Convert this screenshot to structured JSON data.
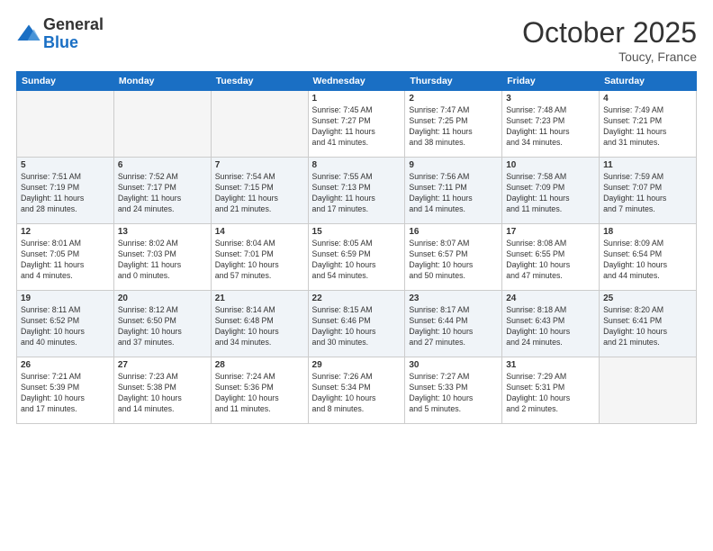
{
  "header": {
    "logo_general": "General",
    "logo_blue": "Blue",
    "month": "October 2025",
    "location": "Toucy, France"
  },
  "days_of_week": [
    "Sunday",
    "Monday",
    "Tuesday",
    "Wednesday",
    "Thursday",
    "Friday",
    "Saturday"
  ],
  "weeks": [
    [
      {
        "day": "",
        "info": ""
      },
      {
        "day": "",
        "info": ""
      },
      {
        "day": "",
        "info": ""
      },
      {
        "day": "1",
        "info": "Sunrise: 7:45 AM\nSunset: 7:27 PM\nDaylight: 11 hours\nand 41 minutes."
      },
      {
        "day": "2",
        "info": "Sunrise: 7:47 AM\nSunset: 7:25 PM\nDaylight: 11 hours\nand 38 minutes."
      },
      {
        "day": "3",
        "info": "Sunrise: 7:48 AM\nSunset: 7:23 PM\nDaylight: 11 hours\nand 34 minutes."
      },
      {
        "day": "4",
        "info": "Sunrise: 7:49 AM\nSunset: 7:21 PM\nDaylight: 11 hours\nand 31 minutes."
      }
    ],
    [
      {
        "day": "5",
        "info": "Sunrise: 7:51 AM\nSunset: 7:19 PM\nDaylight: 11 hours\nand 28 minutes."
      },
      {
        "day": "6",
        "info": "Sunrise: 7:52 AM\nSunset: 7:17 PM\nDaylight: 11 hours\nand 24 minutes."
      },
      {
        "day": "7",
        "info": "Sunrise: 7:54 AM\nSunset: 7:15 PM\nDaylight: 11 hours\nand 21 minutes."
      },
      {
        "day": "8",
        "info": "Sunrise: 7:55 AM\nSunset: 7:13 PM\nDaylight: 11 hours\nand 17 minutes."
      },
      {
        "day": "9",
        "info": "Sunrise: 7:56 AM\nSunset: 7:11 PM\nDaylight: 11 hours\nand 14 minutes."
      },
      {
        "day": "10",
        "info": "Sunrise: 7:58 AM\nSunset: 7:09 PM\nDaylight: 11 hours\nand 11 minutes."
      },
      {
        "day": "11",
        "info": "Sunrise: 7:59 AM\nSunset: 7:07 PM\nDaylight: 11 hours\nand 7 minutes."
      }
    ],
    [
      {
        "day": "12",
        "info": "Sunrise: 8:01 AM\nSunset: 7:05 PM\nDaylight: 11 hours\nand 4 minutes."
      },
      {
        "day": "13",
        "info": "Sunrise: 8:02 AM\nSunset: 7:03 PM\nDaylight: 11 hours\nand 0 minutes."
      },
      {
        "day": "14",
        "info": "Sunrise: 8:04 AM\nSunset: 7:01 PM\nDaylight: 10 hours\nand 57 minutes."
      },
      {
        "day": "15",
        "info": "Sunrise: 8:05 AM\nSunset: 6:59 PM\nDaylight: 10 hours\nand 54 minutes."
      },
      {
        "day": "16",
        "info": "Sunrise: 8:07 AM\nSunset: 6:57 PM\nDaylight: 10 hours\nand 50 minutes."
      },
      {
        "day": "17",
        "info": "Sunrise: 8:08 AM\nSunset: 6:55 PM\nDaylight: 10 hours\nand 47 minutes."
      },
      {
        "day": "18",
        "info": "Sunrise: 8:09 AM\nSunset: 6:54 PM\nDaylight: 10 hours\nand 44 minutes."
      }
    ],
    [
      {
        "day": "19",
        "info": "Sunrise: 8:11 AM\nSunset: 6:52 PM\nDaylight: 10 hours\nand 40 minutes."
      },
      {
        "day": "20",
        "info": "Sunrise: 8:12 AM\nSunset: 6:50 PM\nDaylight: 10 hours\nand 37 minutes."
      },
      {
        "day": "21",
        "info": "Sunrise: 8:14 AM\nSunset: 6:48 PM\nDaylight: 10 hours\nand 34 minutes."
      },
      {
        "day": "22",
        "info": "Sunrise: 8:15 AM\nSunset: 6:46 PM\nDaylight: 10 hours\nand 30 minutes."
      },
      {
        "day": "23",
        "info": "Sunrise: 8:17 AM\nSunset: 6:44 PM\nDaylight: 10 hours\nand 27 minutes."
      },
      {
        "day": "24",
        "info": "Sunrise: 8:18 AM\nSunset: 6:43 PM\nDaylight: 10 hours\nand 24 minutes."
      },
      {
        "day": "25",
        "info": "Sunrise: 8:20 AM\nSunset: 6:41 PM\nDaylight: 10 hours\nand 21 minutes."
      }
    ],
    [
      {
        "day": "26",
        "info": "Sunrise: 7:21 AM\nSunset: 5:39 PM\nDaylight: 10 hours\nand 17 minutes."
      },
      {
        "day": "27",
        "info": "Sunrise: 7:23 AM\nSunset: 5:38 PM\nDaylight: 10 hours\nand 14 minutes."
      },
      {
        "day": "28",
        "info": "Sunrise: 7:24 AM\nSunset: 5:36 PM\nDaylight: 10 hours\nand 11 minutes."
      },
      {
        "day": "29",
        "info": "Sunrise: 7:26 AM\nSunset: 5:34 PM\nDaylight: 10 hours\nand 8 minutes."
      },
      {
        "day": "30",
        "info": "Sunrise: 7:27 AM\nSunset: 5:33 PM\nDaylight: 10 hours\nand 5 minutes."
      },
      {
        "day": "31",
        "info": "Sunrise: 7:29 AM\nSunset: 5:31 PM\nDaylight: 10 hours\nand 2 minutes."
      },
      {
        "day": "",
        "info": ""
      }
    ]
  ]
}
